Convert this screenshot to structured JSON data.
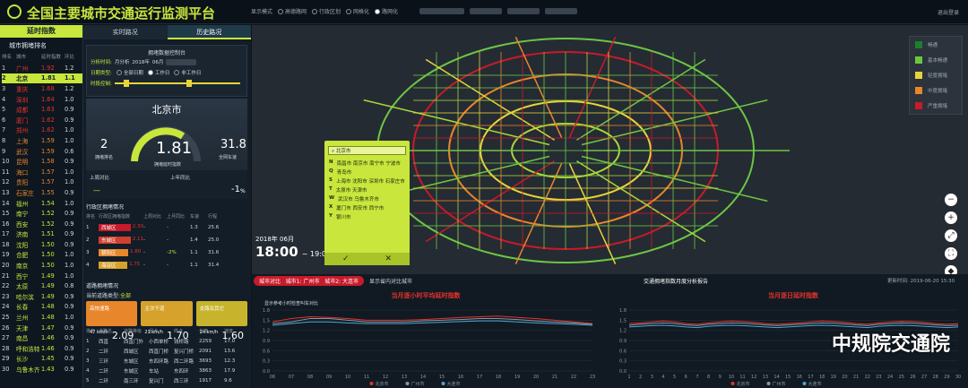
{
  "header": {
    "title": "全国主要城市交通运行监测平台",
    "display_mode_label": "显示模式",
    "modes": [
      "高德路网",
      "行政区划",
      "网格化",
      "路网化"
    ],
    "login": "退出登录"
  },
  "left": {
    "tab": "延时指数",
    "subtitle": "城市拥堵排名",
    "columns": [
      "排名",
      "城市",
      "延时指数",
      "环比"
    ],
    "rows": [
      [
        "1",
        "广州",
        "1.92",
        "1.2"
      ],
      [
        "2",
        "北京",
        "1.81",
        "1.1"
      ],
      [
        "3",
        "重庆",
        "1.68",
        "1.2"
      ],
      [
        "4",
        "深圳",
        "1.64",
        "1.0"
      ],
      [
        "5",
        "成都",
        "1.63",
        "0.9"
      ],
      [
        "6",
        "厦门",
        "1.62",
        "0.9"
      ],
      [
        "7",
        "郑州",
        "1.62",
        "1.0"
      ],
      [
        "8",
        "上海",
        "1.59",
        "1.0"
      ],
      [
        "9",
        "武汉",
        "1.59",
        "0.6"
      ],
      [
        "10",
        "昆明",
        "1.58",
        "0.9"
      ],
      [
        "11",
        "海口",
        "1.57",
        "1.0"
      ],
      [
        "12",
        "贵阳",
        "1.57",
        "1.0"
      ],
      [
        "13",
        "石家庄",
        "1.55",
        "0.9"
      ],
      [
        "14",
        "福州",
        "1.54",
        "1.0"
      ],
      [
        "15",
        "南宁",
        "1.52",
        "0.9"
      ],
      [
        "16",
        "西安",
        "1.52",
        "0.9"
      ],
      [
        "17",
        "济南",
        "1.51",
        "0.9"
      ],
      [
        "18",
        "沈阳",
        "1.50",
        "0.9"
      ],
      [
        "19",
        "合肥",
        "1.50",
        "1.0"
      ],
      [
        "20",
        "南京",
        "1.50",
        "1.0"
      ],
      [
        "21",
        "西宁",
        "1.49",
        "1.0"
      ],
      [
        "22",
        "太原",
        "1.49",
        "0.8"
      ],
      [
        "23",
        "哈尔滨",
        "1.49",
        "0.9"
      ],
      [
        "24",
        "长春",
        "1.48",
        "0.9"
      ],
      [
        "25",
        "兰州",
        "1.48",
        "1.0"
      ],
      [
        "26",
        "天津",
        "1.47",
        "0.9"
      ],
      [
        "27",
        "南昌",
        "1.46",
        "0.9"
      ],
      [
        "28",
        "呼和浩特",
        "1.46",
        "0.9"
      ],
      [
        "29",
        "长沙",
        "1.45",
        "0.9"
      ],
      [
        "30",
        "乌鲁木齐",
        "1.43",
        "0.9"
      ]
    ]
  },
  "mid": {
    "tabs": [
      "实时路况",
      "历史路况"
    ],
    "query": {
      "title": "拥堵数据控制台",
      "time_label": "分析时间:",
      "time_value": "月分析",
      "year": "2018年",
      "month": "06月",
      "date_type_label": "日期类型:",
      "date_types": [
        "全部日期",
        "工作日",
        "非工作日"
      ],
      "hour_label": "时段控制:"
    },
    "city": {
      "name": "北京市",
      "rank": "2",
      "rank_label": "拥堵排名",
      "index": "1.81",
      "index_label": "拥堵延时指数",
      "speed": "31.8",
      "speed_label": "全网车速",
      "last_week_label": "上周对比",
      "last_week_value": "—",
      "last_year_label": "上年同比",
      "last_year_value": "-1",
      "last_year_unit": "%"
    },
    "district": {
      "title": "行政区拥堵情况",
      "columns": [
        "排名",
        "行政区拥堵指数",
        "上周对比",
        "上月同比",
        "车速",
        "行程"
      ],
      "rows": [
        [
          "1",
          "西城区",
          "2.30",
          "-",
          "-",
          "1.3",
          "25.6"
        ],
        [
          "2",
          "东城区",
          "2.11",
          "-",
          "-",
          "1.4",
          "25.0"
        ],
        [
          "3",
          "朝阳区",
          "1.80",
          "-",
          "-2%",
          "1.1",
          "31.6"
        ],
        [
          "4",
          "海淀区",
          "1.75",
          "-",
          "-",
          "1.1",
          "31.4"
        ]
      ]
    },
    "roads": {
      "title": "道路拥堵情况",
      "subtitle": "当前道路类型:",
      "road_type": "全部",
      "kpis": [
        {
          "label": "高快速路",
          "value": "2.09",
          "sub": "47 km/h"
        },
        {
          "label": "主次干道",
          "value": "1.70",
          "sub": "21 km/h"
        },
        {
          "label": "支路及其它",
          "value": "1.60",
          "sub": "24 km/h"
        }
      ],
      "columns": [
        "排名",
        "道路名",
        "道路等级",
        "起点",
        "终点",
        "长度",
        "速度"
      ],
      "rows": [
        [
          "1",
          "西直",
          "西直门外",
          "小西单桥",
          "钱桥路",
          "2259",
          "17.0"
        ],
        [
          "2",
          "二环",
          "西城区",
          "西直门桥",
          "复兴门桥",
          "2091",
          "13.6"
        ],
        [
          "3",
          "三环",
          "东城区",
          "东四环路",
          "西二环路",
          "3693",
          "12.3"
        ],
        [
          "4",
          "二环",
          "东城区",
          "车站",
          "东四环",
          "3863",
          "17.9"
        ],
        [
          "5",
          "二环",
          "南三环",
          "复兴门",
          "西三环",
          "1917",
          "9.6"
        ]
      ]
    }
  },
  "map": {
    "legend": [
      "畅通",
      "基本畅通",
      "轻度拥堵",
      "中度拥堵",
      "严重拥堵"
    ],
    "legend_colors": [
      "#1a7f2e",
      "#6cc644",
      "#e6d43a",
      "#e8862c",
      "#c81a2a"
    ],
    "date": "2018年 06月",
    "time": "18:00",
    "time_to": "~ 19:00",
    "popup": {
      "search": "北京市",
      "groups": [
        [
          "N",
          "南昌市 南京市 南宁市 宁波市"
        ],
        [
          "Q",
          "青岛市"
        ],
        [
          "S",
          "上海市 沈阳市 深圳市 石家庄市"
        ],
        [
          "T",
          "太原市 天津市"
        ],
        [
          "W",
          "武汉市 乌鲁木齐市"
        ],
        [
          "X",
          "厦门市 西安市 西宁市"
        ],
        [
          "Y",
          "银川市"
        ]
      ]
    },
    "zoom": [
      "−",
      "+",
      "⤢",
      "⛶",
      "◆"
    ]
  },
  "bottom": {
    "compare_label": "城市对比",
    "city1": "城市1: 广州市",
    "city2": "城市2: 大连市",
    "show_region": "显示省内对比城市",
    "report": "交通拥堵指数月度分析报告",
    "update": "更新时间: 2019-06-20 15:30",
    "chart1_title": "当月逐小时平均延时指数",
    "chart1_toggle": "显示参考小时检查叫车对比",
    "chart2_title": "当月逐日延时指数",
    "watermark": "中规院交通院"
  },
  "chart_data": [
    {
      "type": "line",
      "title": "当月逐小时平均延时指数",
      "x": [
        "06",
        "07",
        "08",
        "09",
        "10",
        "11",
        "12",
        "13",
        "14",
        "15",
        "16",
        "17",
        "18",
        "19",
        "20",
        "21",
        "22",
        "23"
      ],
      "ylim": [
        0,
        1.8
      ],
      "series": [
        {
          "name": "北京市",
          "values": [
            1.45,
            1.55,
            1.6,
            1.58,
            1.55,
            1.5,
            1.5,
            1.5,
            1.52,
            1.55,
            1.58,
            1.6,
            1.62,
            1.58,
            1.55,
            1.5,
            1.45,
            1.4
          ]
        },
        {
          "name": "广州市",
          "values": [
            1.4,
            1.45,
            1.55,
            1.55,
            1.5,
            1.45,
            1.45,
            1.45,
            1.48,
            1.5,
            1.52,
            1.55,
            1.55,
            1.52,
            1.48,
            1.45,
            1.42,
            1.38
          ]
        },
        {
          "name": "大连市",
          "values": [
            1.35,
            1.4,
            1.45,
            1.45,
            1.42,
            1.4,
            1.4,
            1.4,
            1.42,
            1.44,
            1.46,
            1.48,
            1.48,
            1.45,
            1.42,
            1.4,
            1.38,
            1.35
          ]
        }
      ]
    },
    {
      "type": "line",
      "title": "当月逐日延时指数",
      "x": [
        "1",
        "2",
        "3",
        "4",
        "5",
        "6",
        "7",
        "8",
        "9",
        "10",
        "11",
        "12",
        "13",
        "14",
        "15",
        "16",
        "17",
        "18",
        "19",
        "20",
        "21",
        "22",
        "23",
        "24",
        "25",
        "26",
        "27",
        "28",
        "29",
        "30"
      ],
      "ylim": [
        0,
        1.8
      ],
      "series": [
        {
          "name": "北京市",
          "values": [
            1.4,
            1.42,
            1.45,
            1.48,
            1.45,
            1.4,
            1.38,
            1.42,
            1.45,
            1.48,
            1.46,
            1.44,
            1.4,
            1.38,
            1.4,
            1.42,
            1.45,
            1.48,
            1.46,
            1.44,
            1.4,
            1.38,
            1.42,
            1.45,
            1.47,
            1.46,
            1.44,
            1.4,
            1.38,
            1.4
          ]
        },
        {
          "name": "广州市",
          "values": [
            1.35,
            1.38,
            1.4,
            1.42,
            1.4,
            1.36,
            1.34,
            1.38,
            1.4,
            1.42,
            1.41,
            1.39,
            1.36,
            1.34,
            1.36,
            1.38,
            1.4,
            1.42,
            1.41,
            1.39,
            1.36,
            1.34,
            1.38,
            1.4,
            1.42,
            1.41,
            1.39,
            1.36,
            1.34,
            1.35
          ]
        },
        {
          "name": "大连市",
          "values": [
            1.3,
            1.32,
            1.34,
            1.35,
            1.33,
            1.3,
            1.28,
            1.32,
            1.34,
            1.35,
            1.34,
            1.32,
            1.3,
            1.28,
            1.3,
            1.32,
            1.34,
            1.35,
            1.34,
            1.32,
            1.3,
            1.28,
            1.32,
            1.34,
            1.35,
            1.34,
            1.32,
            1.3,
            1.28,
            1.3
          ]
        }
      ]
    }
  ]
}
